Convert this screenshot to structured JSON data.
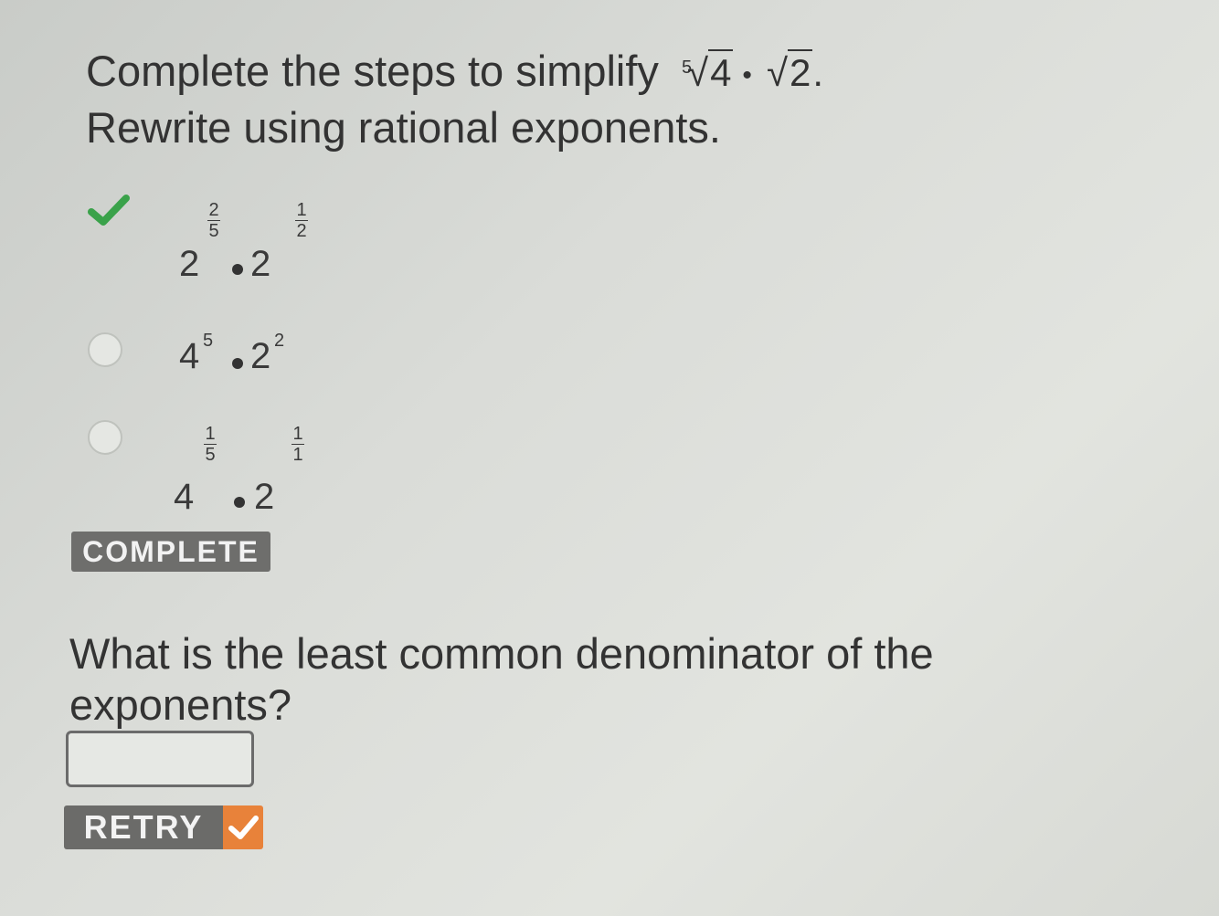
{
  "question1": {
    "prompt": "Complete the steps to simplify",
    "expression": {
      "root_index": "5",
      "radicand_1": "4",
      "operator": "•",
      "radicand_2": "2",
      "period": "."
    },
    "instruction": "Rewrite using rational exponents."
  },
  "options": [
    {
      "selected": true,
      "base1": "2",
      "exp1_num": "2",
      "exp1_den": "5",
      "base2": "2",
      "exp2_num": "1",
      "exp2_den": "2"
    },
    {
      "selected": false,
      "base1": "4",
      "exp1": "5",
      "base2": "2",
      "exp2": "2"
    },
    {
      "selected": false,
      "base1": "4",
      "exp1_num": "1",
      "exp1_den": "5",
      "base2": "2",
      "exp2_num": "1",
      "exp2_den": "1"
    }
  ],
  "status_badge": "COMPLETE",
  "question2": {
    "text": "What is the least common denominator of the exponents?",
    "answer_value": ""
  },
  "retry_label": "RETRY",
  "colors": {
    "check_green": "#3aa24a",
    "retry_orange": "#e8823a",
    "badge_gray": "#6e6e6c"
  },
  "icons": {
    "correct": "checkmark-icon",
    "retry_status": "check-icon"
  }
}
